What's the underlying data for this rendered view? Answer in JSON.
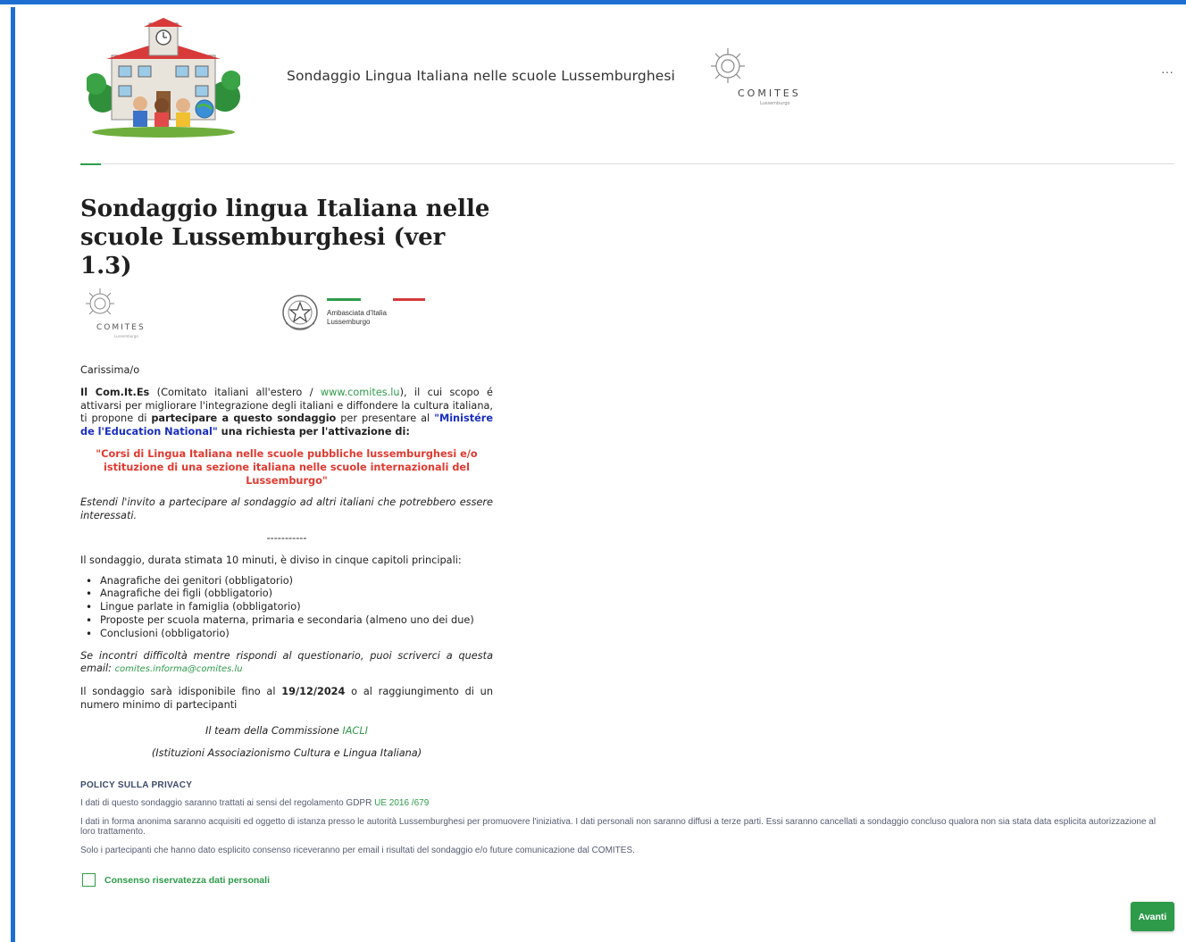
{
  "header": {
    "title": "Sondaggio Lingua Italiana nelle scuole Lussemburghesi",
    "comites_logo_text": "COMITES",
    "comites_logo_subtext": "Lussemburgo",
    "more_label": "···"
  },
  "form": {
    "title": "Sondaggio lingua Italiana nelle scuole Lussemburghesi (ver 1.3)",
    "logos": {
      "comites_text": "COMITES",
      "comites_subtext": "Lussemburgo",
      "embassy_line1": "Ambasciata d'Italia",
      "embassy_line2": "Lussemburgo"
    },
    "greeting": "Carissima/o",
    "intro": {
      "org_bold": "Il Com.It.Es",
      "org_paren_open": " (Comitato italiani all'estero / ",
      "org_link": "www.comites.lu",
      "text_1": "), il cui scopo é attivarsi per migliorare l'integrazione degli italiani e diffondere la cultura italiana, ti propone di ",
      "bold_participate": "partecipare a questo sondaggio",
      "text_2": " per presentare al ",
      "ministry": "\"Ministére de l'Education National\"",
      "bold_request": " una richiesta per l'attivazione di:"
    },
    "highlight": "\"Corsi di Lingua Italiana nelle scuole pubbliche lussemburghesi e/o istituzione di una sezione italiana nelle scuole internazionali del Lussemburgo\"",
    "invite": "Estendi l'invito a partecipare al sondaggio ad altri italiani che potrebbero essere interessati.",
    "separator": "-----------",
    "chapters_intro": "Il sondaggio, durata stimata 10 minuti, è diviso in cinque capitoli principali:",
    "chapters": [
      "Anagrafiche dei genitori (obbligatorio)",
      "Anagrafiche dei figli (obbligatorio)",
      "Lingue parlate in famiglia (obbligatorio)",
      "Proposte per scuola materna, primaria e secondaria (almeno uno dei due)",
      "Conclusioni (obbligatorio)"
    ],
    "help_text": "Se incontri difficoltà mentre rispondi al questionario, puoi scriverci a questa email: ",
    "help_email": "comites.informa@comites.lu",
    "availability_1": "Il sondaggio sarà idisponibile fino al ",
    "availability_date": "19/12/2024",
    "availability_2": " o al raggiungimento di un numero minimo di partecipanti",
    "signature_1": "Il team della Commissione ",
    "signature_link": "IACLI",
    "signature_2": "(Istituzioni Associazionismo Cultura e Lingua Italiana)"
  },
  "privacy": {
    "title": "POLICY SULLA PRIVACY",
    "line1": "I dati di questo sondaggio saranno trattati ai sensi del regolamento GDPR ",
    "line1_link": "UE 2016 /679",
    "line2": "I dati in forma anonima saranno acquisiti ed oggetto di istanza presso le autorità Lussemburghesi per promuovere l'iniziativa. I dati personali non saranno diffusi a terze parti. Essi saranno cancellati a sondaggio concluso qualora non sia stata data esplicita autorizzazione al loro trattamento.",
    "line3": "Solo i partecipanti che hanno dato esplicito consenso riceveranno per email i risultati del sondaggio e/o  future comunicazione dal COMITES."
  },
  "consent": {
    "label": "Consenso riservatezza dati personali"
  },
  "actions": {
    "next_label": "Avanti"
  },
  "colors": {
    "accent_green": "#2e9b4a",
    "frame_blue": "#1c6fd1",
    "highlight_red": "#e03a30",
    "ministry_blue": "#1a2fbf"
  }
}
